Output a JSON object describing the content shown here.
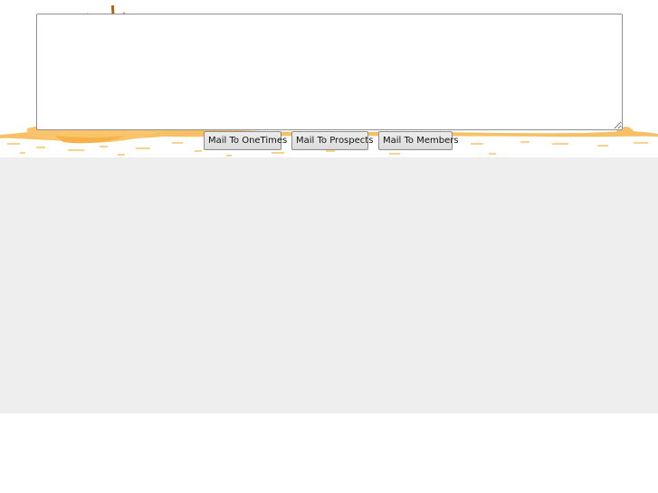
{
  "message": {
    "value": "",
    "placeholder": ""
  },
  "buttons": {
    "onetimes_label": "Mail To OneTimes",
    "prospects_label": "Mail To Prospects",
    "members_label": "Mail To Members"
  },
  "colors": {
    "header_accent": "#f7b84a",
    "header_stick": "#a4660f",
    "panel_background": "#eeeeee",
    "page_background": "#ffffff"
  }
}
